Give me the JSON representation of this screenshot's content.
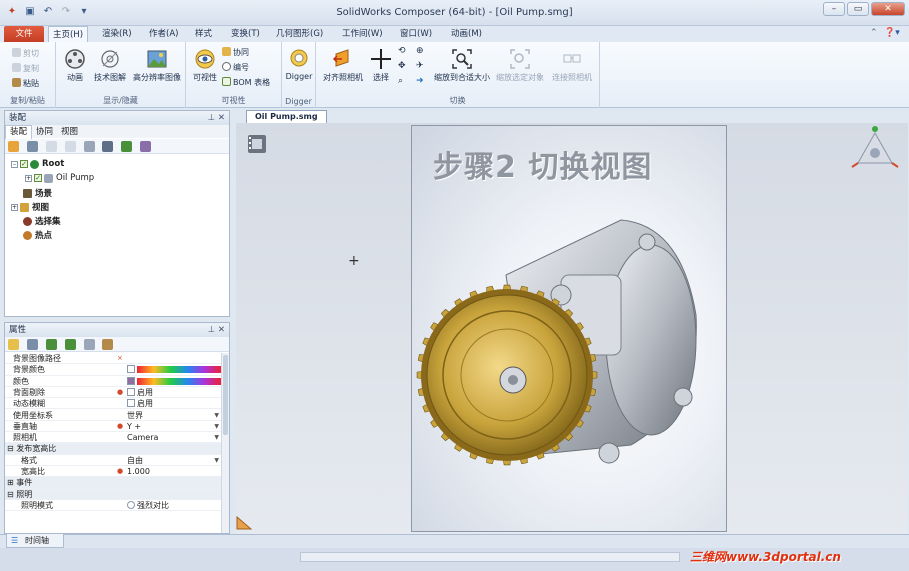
{
  "window": {
    "title": "SolidWorks Composer (64-bit) - [Oil Pump.smg]"
  },
  "colors": {
    "accent": "#c23e24",
    "gear": "#c9a43c",
    "body": "#b8bdc5"
  },
  "tabs": [
    {
      "label": "文件"
    },
    {
      "label": "主页(H)"
    },
    {
      "label": "渲染(R)"
    },
    {
      "label": "作者(A)"
    },
    {
      "label": "样式"
    },
    {
      "label": "变换(T)"
    },
    {
      "label": "几何图形(G)"
    },
    {
      "label": "工作间(W)"
    },
    {
      "label": "窗口(W)"
    },
    {
      "label": "动画(M)"
    }
  ],
  "ribbon": {
    "clipboard": {
      "label": "复制/粘贴",
      "cut": "剪切",
      "copy": "复制",
      "paste": "粘贴"
    },
    "showhide": {
      "label": "显示/隐藏",
      "animation": "动画",
      "techillus": "技术图解",
      "hires": "高分辨率图像"
    },
    "visibility": {
      "label": "可视性",
      "visibility": "可视性",
      "collab": "协同",
      "numbering": "编号",
      "bom": "BOM 表格"
    },
    "digger": {
      "label": "Digger",
      "digger": "Digger"
    },
    "switch": {
      "label": "切换",
      "align_camera": "对齐照相机",
      "select": "选择",
      "zoom_fit": "缩放到合适大小",
      "zoom_selected": "缩放选定对象",
      "connect_camera": "连接照相机"
    }
  },
  "assembly_panel": {
    "title": "装配",
    "tabs": [
      "装配",
      "协同",
      "视图"
    ],
    "tree": [
      {
        "label": "Root"
      },
      {
        "label": "Oil Pump"
      },
      {
        "label": "场景"
      },
      {
        "label": "视图"
      },
      {
        "label": "选择集"
      },
      {
        "label": "热点"
      }
    ]
  },
  "properties_panel": {
    "title": "属性",
    "rows": [
      {
        "key": "背景图像路径",
        "value": ""
      },
      {
        "key": "背景颜色",
        "value": ""
      },
      {
        "key": "颜色",
        "value": ""
      },
      {
        "key": "背面剔除",
        "value": "启用"
      },
      {
        "key": "动态模糊",
        "value": "启用"
      },
      {
        "key": "使用坐标系",
        "value": "世界"
      },
      {
        "key": "垂直轴",
        "value": "Y +"
      },
      {
        "key": "照相机",
        "value": "Camera"
      },
      {
        "key": "发布宽高比",
        "value": ""
      },
      {
        "key": "格式",
        "value": "自由"
      },
      {
        "key": "宽高比",
        "value": "1.000"
      },
      {
        "key": "事件",
        "value": ""
      },
      {
        "key": "照明",
        "value": ""
      },
      {
        "key": "照明模式",
        "value": "强烈对比"
      }
    ]
  },
  "document": {
    "tab": "Oil Pump.smg",
    "headline": "步骤2  切换视图"
  },
  "status": {
    "timeline": "时间轴"
  },
  "watermark": "三维网www.3dportal.cn"
}
